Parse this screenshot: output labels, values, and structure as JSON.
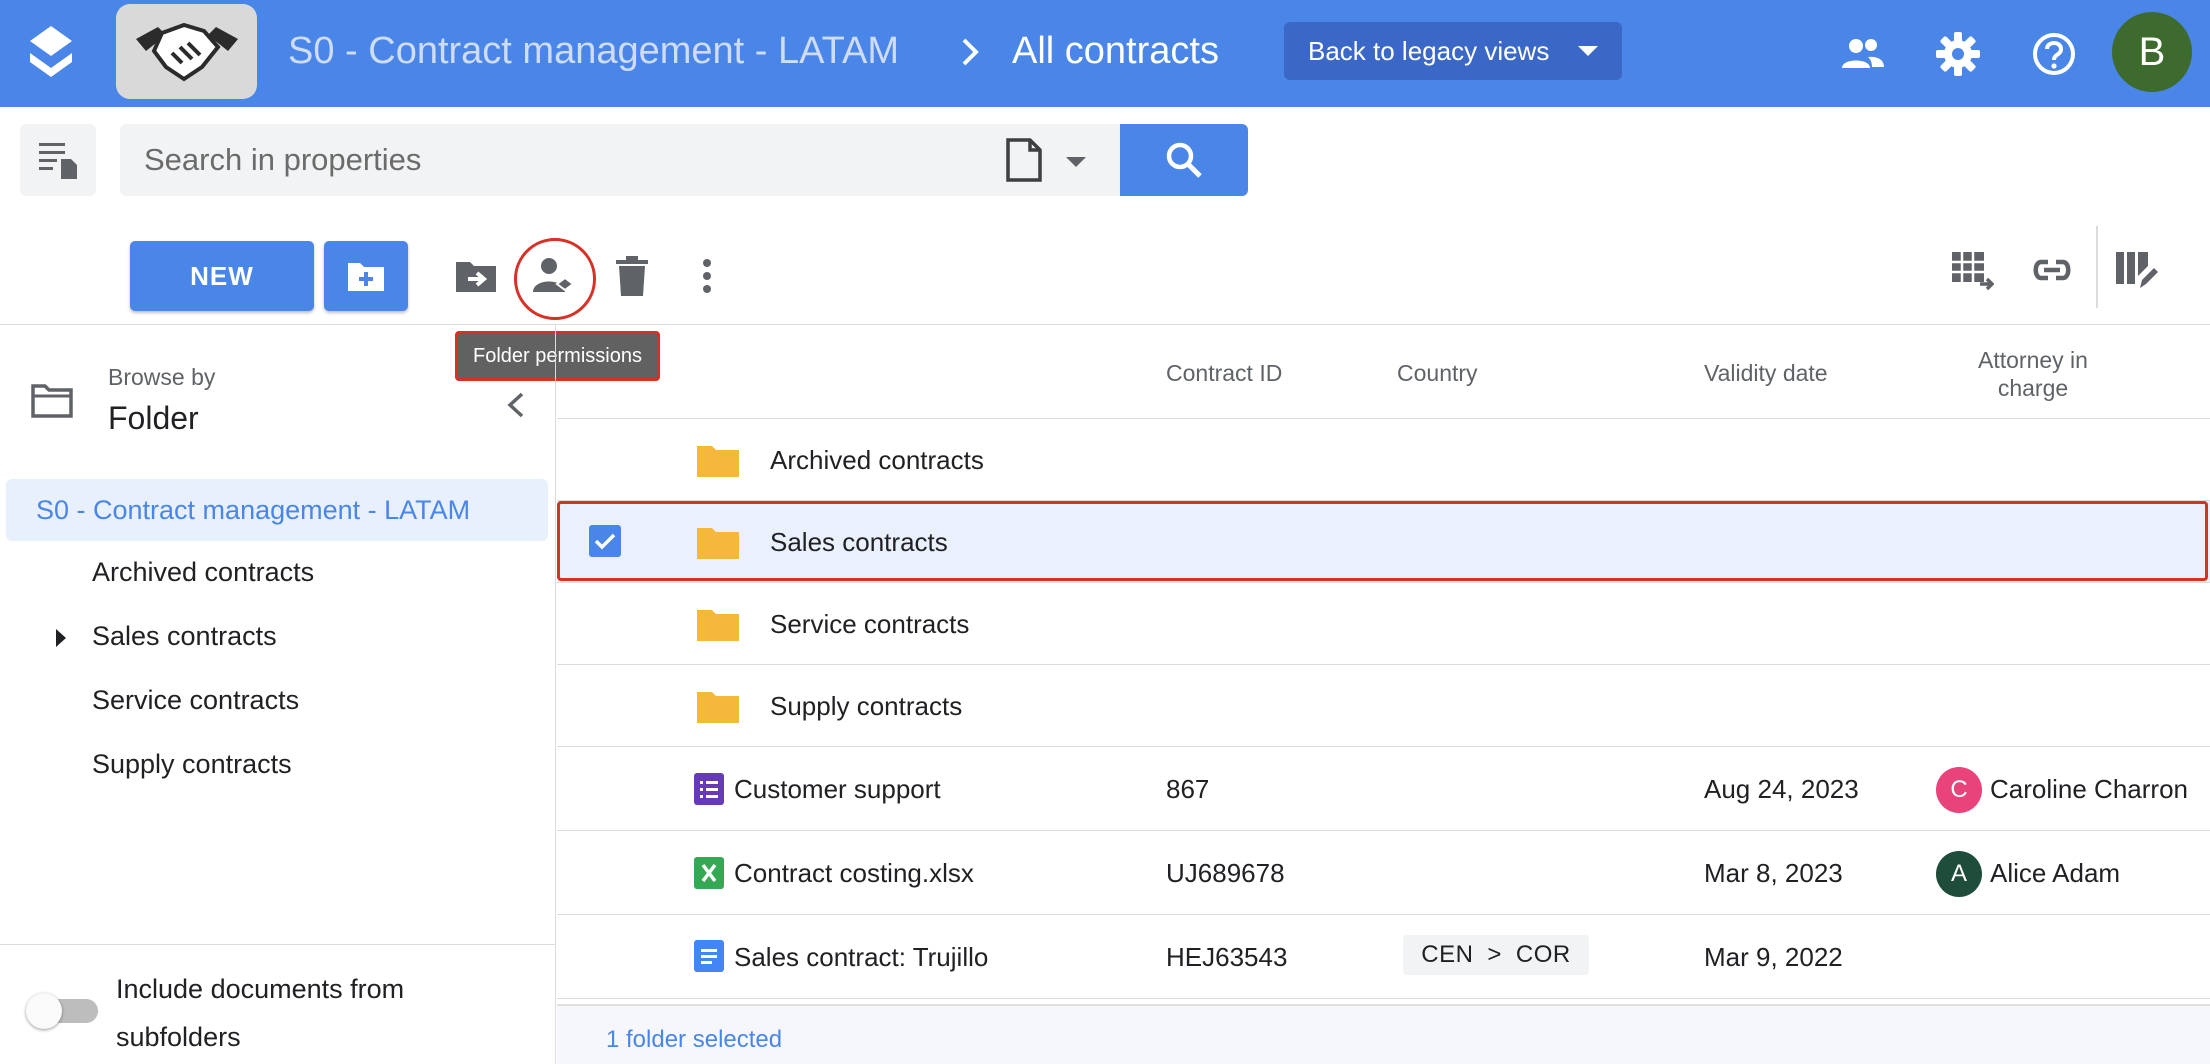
{
  "header": {
    "workspace": "S0 - Contract management - LATAM",
    "separator": ">",
    "current_view": "All contracts",
    "legacy_button": "Back to legacy views",
    "avatar_initial": "B",
    "colors": {
      "bar": "#4a86e8",
      "avatar": "#3d6b2e"
    }
  },
  "search": {
    "placeholder": "Search in properties",
    "value": ""
  },
  "toolbar": {
    "new_label": "NEW",
    "tooltip": "Folder permissions"
  },
  "sidebar": {
    "browse_by_label": "Browse by",
    "browse_by_value": "Folder",
    "root": "S0 - Contract management - LATAM",
    "items": [
      {
        "label": "Archived contracts",
        "expandable": false
      },
      {
        "label": "Sales contracts",
        "expandable": true
      },
      {
        "label": "Service contracts",
        "expandable": false
      },
      {
        "label": "Supply contracts",
        "expandable": false
      }
    ],
    "include_subfolders_label": "Include documents from subfolders",
    "include_subfolders_on": false
  },
  "table": {
    "columns": {
      "contract_id": "Contract ID",
      "country": "Country",
      "validity_date": "Validity date",
      "attorney": "Attorney in charge"
    },
    "folders": [
      {
        "name": "Archived contracts",
        "selected": false
      },
      {
        "name": "Sales contracts",
        "selected": true
      },
      {
        "name": "Service contracts",
        "selected": false
      },
      {
        "name": "Supply contracts",
        "selected": false
      }
    ],
    "files": [
      {
        "name": "Customer support",
        "type": "form",
        "contract_id": "867",
        "country_from": "",
        "country_to": "",
        "validity_date": "Aug 24, 2023",
        "attorney": "Caroline Charron",
        "attorney_initial": "C",
        "attorney_color": "#e8437b"
      },
      {
        "name": "Contract costing.xlsx",
        "type": "sheet",
        "contract_id": "UJ689678",
        "country_from": "",
        "country_to": "",
        "validity_date": "Mar 8, 2023",
        "attorney": "Alice Adam",
        "attorney_initial": "A",
        "attorney_color": "#1e4d3b"
      },
      {
        "name": "Sales contract: Trujillo",
        "type": "doc",
        "contract_id": "HEJ63543",
        "country_from": "CEN",
        "country_to": "COR",
        "validity_date": "Mar 9, 2022",
        "attorney": "",
        "attorney_initial": "",
        "attorney_color": ""
      }
    ],
    "chip_separator": ">"
  },
  "status": {
    "selection_text": "1 folder selected"
  }
}
